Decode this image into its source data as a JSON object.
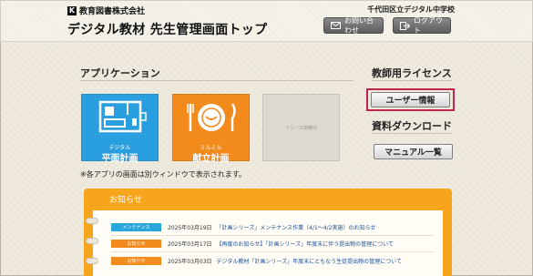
{
  "header": {
    "brand": "教育図書株式会社",
    "brand_mark": "K",
    "title": "デジタル教材 先生管理画面トップ",
    "school": "千代田区立デジタル中学校",
    "contact_label": "お問い合わせ",
    "contact_icon": "mail-icon",
    "logout_label": "ログアウト",
    "logout_icon": "logout-arrow-icon"
  },
  "apps": {
    "title": "アプリケーション",
    "tiles": [
      {
        "sub": "デジタル",
        "name": "平面計画",
        "color": "#2a9fe0",
        "icon": "floor-plan-icon"
      },
      {
        "sub": "ミルミル",
        "name": "献立計画",
        "color": "#f28a1c",
        "icon": "plate-cutlery-icon"
      },
      {
        "soon_label": "リリース準備中",
        "color": "#ddd9d2"
      }
    ],
    "note": "※各アプリの画面は別ウィンドウで表示されます。"
  },
  "license": {
    "title": "教師用ライセンス",
    "user_info_label": "ユーザー情報",
    "highlight_color": "#c2254f"
  },
  "downloads": {
    "title": "資料ダウンロード",
    "manual_label": "マニュアル一覧"
  },
  "notice": {
    "title": "お知らせ",
    "color": "#f7a51d",
    "items": [
      {
        "badge": "メンテナンス",
        "badge_color": "#29a6dc",
        "date": "2025年03月19日",
        "text": "「計画シリーズ」メンテナンス作業（4/1～4/2実施）のお知らせ"
      },
      {
        "badge": "お知らせ",
        "badge_color": "#f28a1c",
        "date": "2025年03月17日",
        "text": "【再度のお知らせ】「計画シリーズ」年度末に伴う提出物の管理について"
      },
      {
        "badge": "お知らせ",
        "badge_color": "#f28a1c",
        "date": "2025年03月03日",
        "text": "デジタル教材「計画シリーズ」年度末にともなう生徒提出物の管理について"
      }
    ]
  }
}
